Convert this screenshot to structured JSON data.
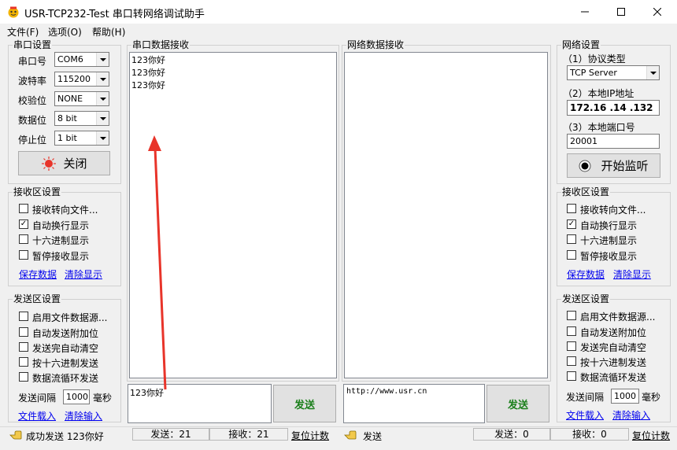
{
  "title": "USR-TCP232-Test 串口转网络调试助手",
  "menu": [
    "文件(F)",
    "选项(O)",
    "帮助(H)"
  ],
  "serial": {
    "group_title": "串口设置",
    "rows": [
      {
        "label": "串口号",
        "value": "COM6"
      },
      {
        "label": "波特率",
        "value": "115200"
      },
      {
        "label": "校验位",
        "value": "NONE"
      },
      {
        "label": "数据位",
        "value": "8 bit"
      },
      {
        "label": "停止位",
        "value": "1 bit"
      }
    ],
    "close_button": "关闭"
  },
  "recv_left": {
    "group_title": "接收区设置",
    "options": [
      {
        "label": "接收转向文件...",
        "checked": false
      },
      {
        "label": "自动换行显示",
        "checked": true
      },
      {
        "label": "十六进制显示",
        "checked": false
      },
      {
        "label": "暂停接收显示",
        "checked": false
      }
    ],
    "save_link": "保存数据",
    "clear_link": "清除显示"
  },
  "send_left": {
    "group_title": "发送区设置",
    "options": [
      {
        "label": "启用文件数据源...",
        "checked": false
      },
      {
        "label": "自动发送附加位",
        "checked": false
      },
      {
        "label": "发送完自动清空",
        "checked": false
      },
      {
        "label": "按十六进制发送",
        "checked": false
      },
      {
        "label": "数据流循环发送",
        "checked": false
      }
    ],
    "interval_label": "发送间隔",
    "interval_value": "1000",
    "interval_unit": "毫秒",
    "load_link": "文件载入",
    "clear_link": "清除输入"
  },
  "serial_recv": {
    "group_title": "串口数据接收",
    "lines": [
      "123你好",
      "123你好",
      "123你好"
    ]
  },
  "net_recv": {
    "group_title": "网络数据接收"
  },
  "serial_send": {
    "text": "123你好",
    "button": "发送"
  },
  "net_send": {
    "text": "http://www.usr.cn",
    "button": "发送"
  },
  "network": {
    "group_title": "网络设置",
    "protocol_label": "（1）协议类型",
    "protocol_value": "TCP Server",
    "ip_label": "（2）本地IP地址",
    "ip_value": "172.16 .14 .132",
    "port_label": "（3）本地端口号",
    "port_value": "20001",
    "listen_button": "开始监听"
  },
  "recv_right": {
    "group_title": "接收区设置",
    "options": [
      {
        "label": "接收转向文件...",
        "checked": false
      },
      {
        "label": "自动换行显示",
        "checked": true
      },
      {
        "label": "十六进制显示",
        "checked": false
      },
      {
        "label": "暂停接收显示",
        "checked": false
      }
    ],
    "save_link": "保存数据",
    "clear_link": "清除显示"
  },
  "send_right": {
    "group_title": "发送区设置",
    "options": [
      {
        "label": "启用文件数据源...",
        "checked": false
      },
      {
        "label": "自动发送附加位",
        "checked": false
      },
      {
        "label": "发送完自动清空",
        "checked": false
      },
      {
        "label": "按十六进制发送",
        "checked": false
      },
      {
        "label": "数据流循环发送",
        "checked": false
      }
    ],
    "interval_label": "发送间隔",
    "interval_value": "1000",
    "interval_unit": "毫秒",
    "load_link": "文件载入",
    "clear_link": "清除输入"
  },
  "status": {
    "left_message": "成功发送 123你好",
    "left_sent": "发送：21",
    "left_recv": "接收：21",
    "left_reset": "复位计数",
    "right_message": "发送",
    "right_sent": "发送：0",
    "right_recv": "接收：0",
    "right_reset": "复位计数"
  },
  "colors": {
    "accent_red": "#e8342a",
    "send_text": "#1a7f1a",
    "link": "#0000ee"
  }
}
